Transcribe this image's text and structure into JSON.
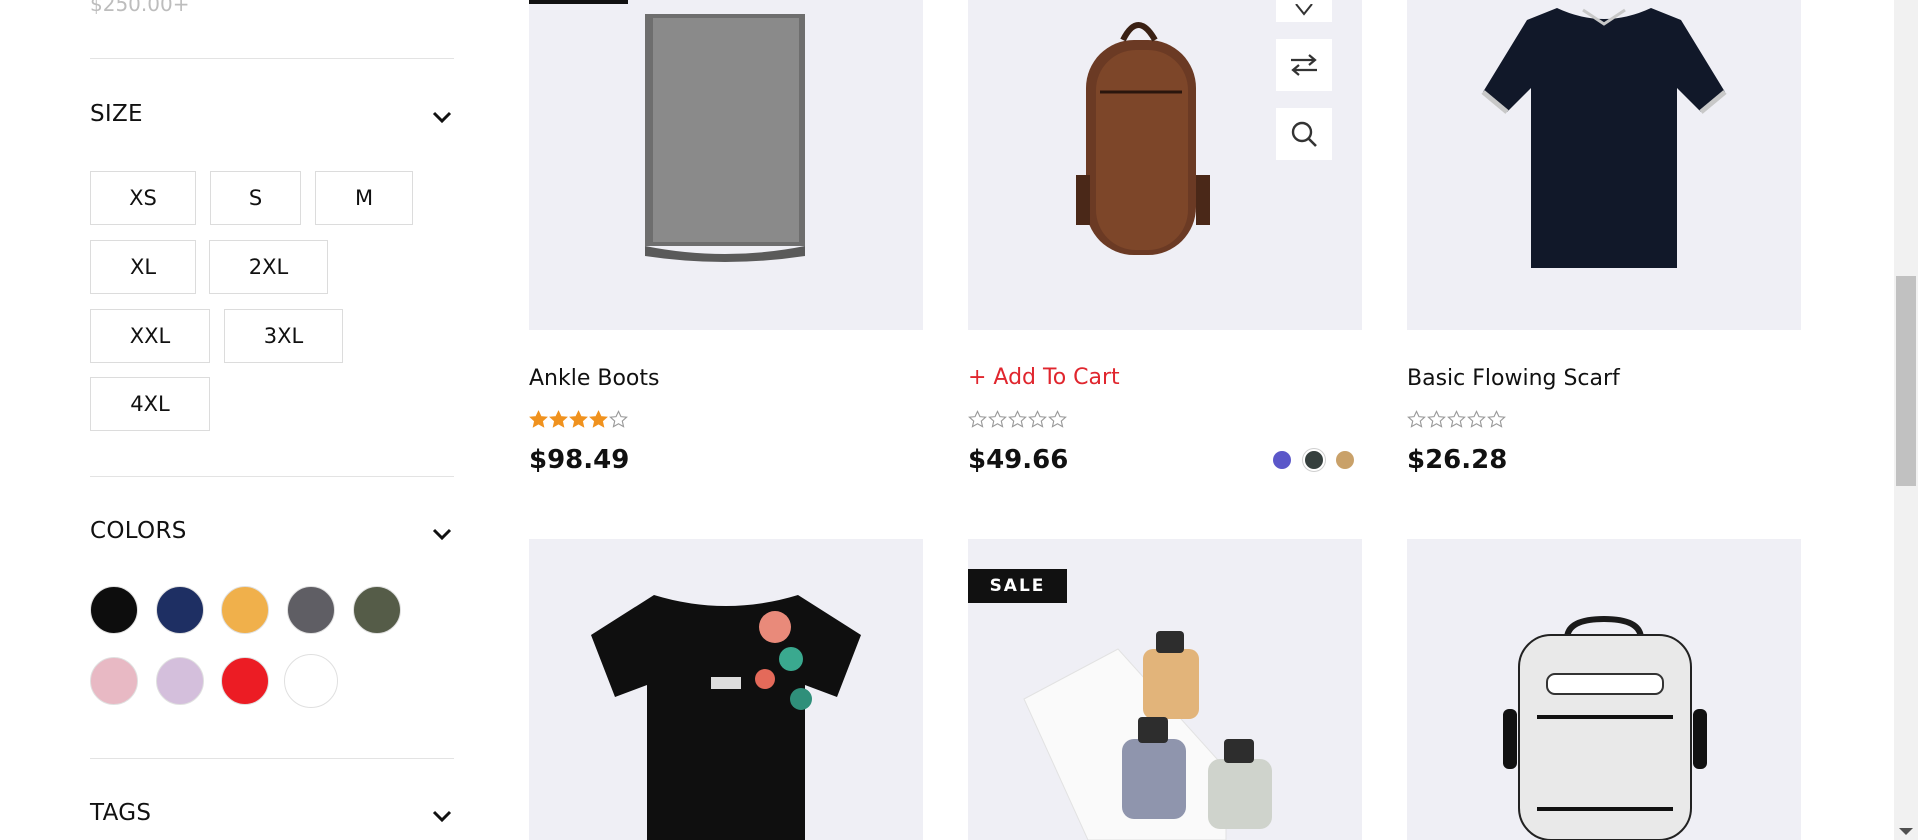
{
  "sidebar": {
    "price_range_last": "$250.00+",
    "size": {
      "title": "SIZE",
      "options": [
        "XS",
        "S",
        "M",
        "XL",
        "2XL",
        "XXL",
        "3XL",
        "4XL"
      ]
    },
    "colors": {
      "title": "COLORS",
      "swatches": [
        "#0d0d0d",
        "#1e2f63",
        "#f0b04b",
        "#5f5e64",
        "#555c48",
        "#e8b9c4",
        "#d4bfdc",
        "#ec1c24",
        "#ffffff"
      ]
    },
    "tags": {
      "title": "TAGS"
    }
  },
  "products": [
    {
      "title": "Ankle Boots",
      "price": "$98.49",
      "rating": 4
    },
    {
      "title": "+ Add To Cart",
      "price": "$49.66",
      "rating": 0,
      "colors": [
        "#5b57c9",
        "#36403e",
        "#c9a169"
      ]
    },
    {
      "title": "Basic Flowing Scarf",
      "price": "$26.28",
      "rating": 0
    }
  ],
  "row2": {
    "sale_badge": "SALE"
  },
  "accent": "#e0262e",
  "star_color": "#f0921e"
}
